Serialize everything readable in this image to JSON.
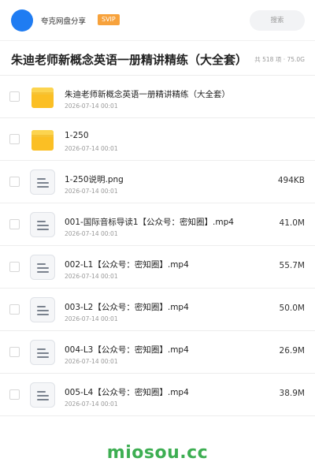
{
  "header": {
    "share_title": "夸克网盘分享",
    "badge": "SVIP",
    "search_placeholder": "搜索",
    "colors": {
      "avatar": "#1f7cf2",
      "badge": "#f7a23c"
    }
  },
  "title": {
    "text": "朱迪老师新概念英语一册精讲精练（大全套）",
    "meta": "共 518 项 · 75.0G"
  },
  "files": [
    {
      "type": "folder",
      "icon": "folder-icon",
      "name": "朱迪老师新概念英语一册精讲精练（大全套）",
      "date": "2026-07-14 00:01",
      "size": ""
    },
    {
      "type": "folder",
      "icon": "folder-icon",
      "name": "1-250",
      "date": "2026-07-14 00:01",
      "size": ""
    },
    {
      "type": "file",
      "icon": "document-icon",
      "name": "1-250说明.png",
      "date": "2026-07-14 00:01",
      "size": "494KB"
    },
    {
      "type": "file",
      "icon": "document-icon",
      "name": "001-国际音标导读1【公众号：密知圈】.mp4",
      "date": "2026-07-14 00:01",
      "size": "41.0M"
    },
    {
      "type": "file",
      "icon": "document-icon",
      "name": "002-L1【公众号：密知圈】.mp4",
      "date": "2026-07-14 00:01",
      "size": "55.7M"
    },
    {
      "type": "file",
      "icon": "document-icon",
      "name": "003-L2【公众号：密知圈】.mp4",
      "date": "2026-07-14 00:01",
      "size": "50.0M"
    },
    {
      "type": "file",
      "icon": "document-icon",
      "name": "004-L3【公众号：密知圈】.mp4",
      "date": "2026-07-14 00:01",
      "size": "26.9M"
    },
    {
      "type": "file",
      "icon": "document-icon",
      "name": "005-L4【公众号：密知圈】.mp4",
      "date": "2026-07-14 00:01",
      "size": "38.9M"
    }
  ],
  "watermark": "miosou.cc"
}
